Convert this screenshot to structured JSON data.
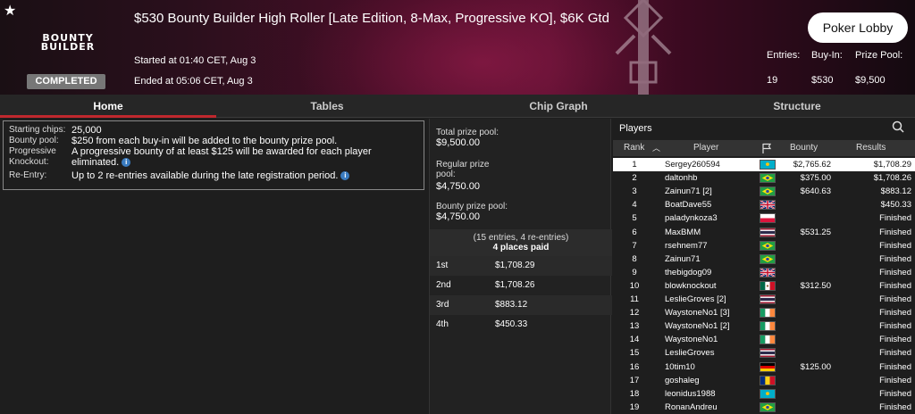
{
  "header": {
    "title": "$530 Bounty Builder High Roller [Late Edition, 8-Max, Progressive KO], $6K Gtd",
    "started": "Started at 01:40 CET, Aug 3",
    "ended": "Ended at 05:06 CET, Aug 3",
    "status": "COMPLETED",
    "logo_line1": "BOUNTY",
    "logo_line2": "BUILDER",
    "lobby_button": "Poker Lobby",
    "stats": [
      {
        "label": "Entries:",
        "value": "19"
      },
      {
        "label": "Buy-In:",
        "value": "$530"
      },
      {
        "label": "Prize Pool:",
        "value": "$9,500"
      }
    ]
  },
  "tabs": [
    "Home",
    "Tables",
    "Chip Graph",
    "Structure"
  ],
  "info": {
    "starting_chips_label": "Starting chips:",
    "starting_chips": "25,000",
    "bounty_pool_label": "Bounty pool:",
    "bounty_pool": "$250 from each buy-in will be added to the bounty prize pool.",
    "progressive_label": "Progressive Knockout:",
    "progressive": "A progressive bounty of at least $125 will be awarded for each player eliminated.",
    "reentry_label": "Re-Entry:",
    "reentry": "Up to 2 re-entries available during the late registration period."
  },
  "prize": {
    "total_label": "Total prize pool:",
    "total": "$9,500.00",
    "regular_label": "Regular prize pool:",
    "regular": "$4,750.00",
    "bounty_label": "Bounty prize pool:",
    "bounty": "$4,750.00",
    "entries_note": "(15 entries, 4 re-entries)",
    "places_paid": "4 places paid",
    "places": [
      {
        "pos": "1st",
        "amount": "$1,708.29"
      },
      {
        "pos": "2nd",
        "amount": "$1,708.26"
      },
      {
        "pos": "3rd",
        "amount": "$883.12"
      },
      {
        "pos": "4th",
        "amount": "$450.33"
      }
    ]
  },
  "players": {
    "title": "Players",
    "columns": {
      "rank": "Rank",
      "player": "Player",
      "bounty": "Bounty",
      "results": "Results"
    },
    "rows": [
      {
        "rank": "1",
        "name": "Sergey260594",
        "flag": "kazakhstan",
        "bounty": "$2,765.62",
        "result": "$1,708.29"
      },
      {
        "rank": "2",
        "name": "daltonhb",
        "flag": "brazil",
        "bounty": "$375.00",
        "result": "$1,708.26"
      },
      {
        "rank": "3",
        "name": "Zainun71 [2]",
        "flag": "brazil",
        "bounty": "$640.63",
        "result": "$883.12"
      },
      {
        "rank": "4",
        "name": "BoatDave55",
        "flag": "uk",
        "bounty": "",
        "result": "$450.33"
      },
      {
        "rank": "5",
        "name": "paladynkoza3",
        "flag": "poland",
        "bounty": "",
        "result": "Finished"
      },
      {
        "rank": "6",
        "name": "MaxBMM",
        "flag": "thailand",
        "bounty": "$531.25",
        "result": "Finished"
      },
      {
        "rank": "7",
        "name": "rsehnem77",
        "flag": "brazil",
        "bounty": "",
        "result": "Finished"
      },
      {
        "rank": "8",
        "name": "Zainun71",
        "flag": "brazil",
        "bounty": "",
        "result": "Finished"
      },
      {
        "rank": "9",
        "name": "thebigdog09",
        "flag": "uk",
        "bounty": "",
        "result": "Finished"
      },
      {
        "rank": "10",
        "name": "blowknockout",
        "flag": "mexico",
        "bounty": "$312.50",
        "result": "Finished"
      },
      {
        "rank": "11",
        "name": "LeslieGroves [2]",
        "flag": "thailand",
        "bounty": "",
        "result": "Finished"
      },
      {
        "rank": "12",
        "name": "WaystoneNo1 [3]",
        "flag": "ireland",
        "bounty": "",
        "result": "Finished"
      },
      {
        "rank": "13",
        "name": "WaystoneNo1 [2]",
        "flag": "ireland",
        "bounty": "",
        "result": "Finished"
      },
      {
        "rank": "14",
        "name": "WaystoneNo1",
        "flag": "ireland",
        "bounty": "",
        "result": "Finished"
      },
      {
        "rank": "15",
        "name": "LeslieGroves",
        "flag": "thailand",
        "bounty": "",
        "result": "Finished"
      },
      {
        "rank": "16",
        "name": "10tim10",
        "flag": "germany",
        "bounty": "$125.00",
        "result": "Finished"
      },
      {
        "rank": "17",
        "name": "goshaleg",
        "flag": "romania",
        "bounty": "",
        "result": "Finished"
      },
      {
        "rank": "18",
        "name": "leonidus1988",
        "flag": "kazakhstan",
        "bounty": "",
        "result": "Finished"
      },
      {
        "rank": "19",
        "name": "RonanAndreu",
        "flag": "brazil",
        "bounty": "",
        "result": "Finished"
      }
    ]
  }
}
